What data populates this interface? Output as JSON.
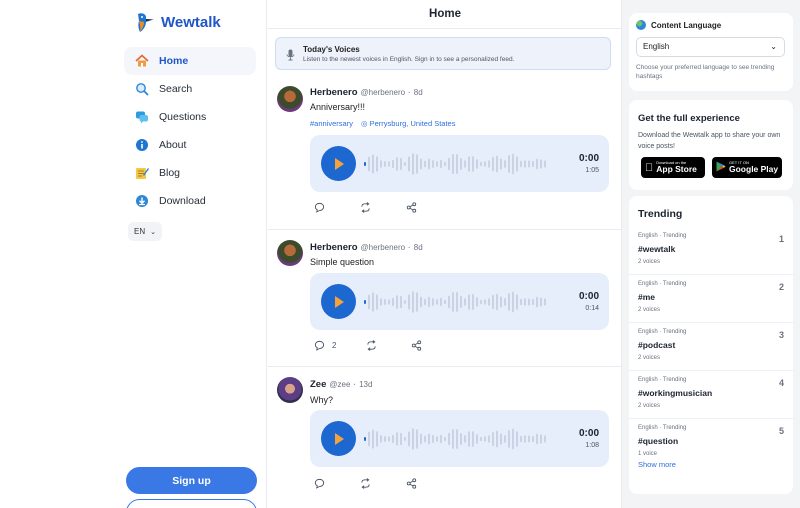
{
  "app": {
    "name": "Wewtalk"
  },
  "sidebar": {
    "items": [
      {
        "label": "Home",
        "icon": "home-icon"
      },
      {
        "label": "Search",
        "icon": "search-icon"
      },
      {
        "label": "Questions",
        "icon": "questions-icon"
      },
      {
        "label": "About",
        "icon": "info-icon"
      },
      {
        "label": "Blog",
        "icon": "blog-icon"
      },
      {
        "label": "Download",
        "icon": "download-icon"
      }
    ],
    "language": "EN",
    "signup_label": "Sign up"
  },
  "main": {
    "title": "Home",
    "banner": {
      "title": "Today's Voices",
      "text": "Listen to the newest voices in English. Sign in to see a personalized feed."
    },
    "posts": [
      {
        "name": "Herbenero",
        "handle": "@herbenero",
        "age": "8d",
        "text": "Anniversary!!!",
        "hashtag": "#anniversary",
        "location": "Perrysburg, United States",
        "current": "0:00",
        "duration": "1:05",
        "comments": ""
      },
      {
        "name": "Herbenero",
        "handle": "@herbenero",
        "age": "8d",
        "text": "Simple question",
        "current": "0:00",
        "duration": "0:14",
        "comments": "2"
      },
      {
        "name": "Zee",
        "handle": "@zee",
        "age": "13d",
        "text": "Why?",
        "current": "0:00",
        "duration": "1:08",
        "comments": ""
      }
    ]
  },
  "right": {
    "content_language": {
      "title": "Content Language",
      "selected": "English",
      "help": "Choose your preferred language to see trending hashtags"
    },
    "get_app": {
      "title": "Get the full experience",
      "text": "Download the Wewtalk app to share your own voice posts!",
      "appstore_small": "Download on the",
      "appstore_large": "App Store",
      "play_small": "GET IT ON",
      "play_large": "Google Play"
    },
    "trending": {
      "title": "Trending",
      "items": [
        {
          "meta": "English · Trending",
          "tag": "#wewtalk",
          "count": "2 voices",
          "rank": "1"
        },
        {
          "meta": "English · Trending",
          "tag": "#me",
          "count": "2 voices",
          "rank": "2"
        },
        {
          "meta": "English · Trending",
          "tag": "#podcast",
          "count": "2 voices",
          "rank": "3"
        },
        {
          "meta": "English · Trending",
          "tag": "#workingmusician",
          "count": "2 voices",
          "rank": "4"
        },
        {
          "meta": "English · Trending",
          "tag": "#question",
          "count": "1 voice",
          "rank": "5"
        }
      ],
      "show_more": "Show more"
    }
  },
  "colors": {
    "accent": "#1f56c9",
    "play_button": "#1d67d1",
    "player_bg": "#e7eefb",
    "link": "#2f6fe0"
  }
}
